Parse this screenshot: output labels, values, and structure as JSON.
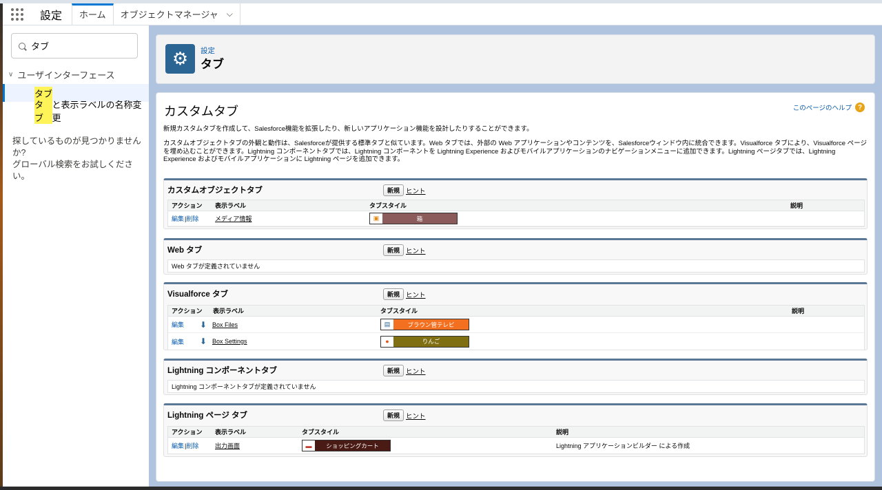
{
  "topbar": {
    "app_name": "設定",
    "tabs": [
      "ホーム",
      "オブジェクトマネージャ"
    ]
  },
  "sidebar": {
    "search_value": "タブ",
    "tree_heading": "ユーザインターフェース",
    "items": [
      {
        "highlight": "タブ",
        "rest": ""
      },
      {
        "highlight": "タブ",
        "rest": "と表示ラベルの名称変更"
      }
    ],
    "help_line1": "探しているものが見つかりませんか?",
    "help_line2": "グローバル検索をお試しください。"
  },
  "header": {
    "breadcrumb": "設定",
    "title": "タブ"
  },
  "page": {
    "heading": "カスタムタブ",
    "help_link": "このページのヘルプ",
    "help_icon": "?",
    "intro1": "新規カスタムタブを作成して、Salesforce機能を拡張したり、新しいアプリケーション機能を設計したりすることができます。",
    "intro2": "カスタムオブジェクトタブの外観と動作は、Salesforceが提供する標準タブと似ています。Web タブでは、外部の Web アプリケーションやコンテンツを、Salesforceウィンドウ内に統合できます。Visualforce タブにより、Visualforce ページを埋め込むことができます。Lightning コンポーネントタブでは、Lightning コンポーネントを Lightning Experience およびモバイルアプリケーションのナビゲーションメニューに追加できます。Lightning ページタブでは、Lightning Experience およびモバイルアプリケーションに Lightning ページを追加できます。"
  },
  "labels": {
    "new": "新規",
    "hint": "ヒント",
    "edit": "編集",
    "delete": "削除",
    "sep": " | ",
    "col_action": "アクション",
    "col_label": "表示ラベル",
    "col_style": "タブスタイル",
    "col_desc": "説明"
  },
  "sections": {
    "custom_object": {
      "title": "カスタムオブジェクトタブ",
      "rows": [
        {
          "label": "メディア情報",
          "style": "箱",
          "color": "#8b5a5a"
        }
      ]
    },
    "web": {
      "title": "Web タブ",
      "empty": "Web タブが定義されていません"
    },
    "visualforce": {
      "title": "Visualforce タブ",
      "rows": [
        {
          "label": "Box Files",
          "style": "ブラウン管テレビ",
          "color": "#f37021"
        },
        {
          "label": "Box Settings",
          "style": "りんご",
          "color": "#7f6e12"
        }
      ]
    },
    "lightning_component": {
      "title": "Lightning コンポーネントタブ",
      "empty": "Lightning コンポーネントタブが定義されていません"
    },
    "lightning_page": {
      "title": "Lightning ページ タブ",
      "rows": [
        {
          "label": "出力画面",
          "style": "ショッピングカート",
          "color": "#4a1a14",
          "desc": "Lightning アプリケーションビルダー による作成"
        }
      ]
    }
  },
  "colors": {
    "accent": "#0176d3",
    "header_icon": "#2a6594",
    "section_border": "#5a7896"
  }
}
